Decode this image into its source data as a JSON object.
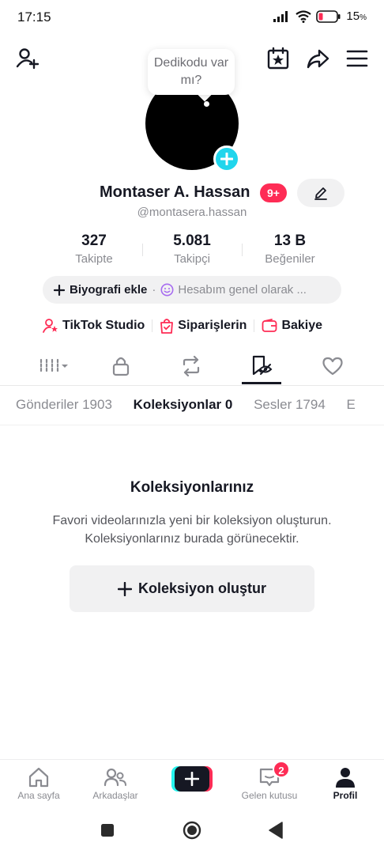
{
  "status_bar": {
    "time": "17:15",
    "battery_percent": "15",
    "battery_sign": "%",
    "icons": [
      "signal-icon",
      "wifi-icon",
      "battery-low-icon"
    ]
  },
  "top_bar": {
    "icons": [
      "add-friend-icon",
      "calendar-star-icon",
      "share-icon",
      "menu-icon"
    ]
  },
  "profile": {
    "note_bubble": "Dedikodu var mı?",
    "display_name": "Montaser A. Hassan",
    "badge": "9+",
    "username": "@montasera.hassan",
    "stats": [
      {
        "value": "327",
        "label": "Takipte"
      },
      {
        "value": "5.081",
        "label": "Takipçi"
      },
      {
        "value": "13 B",
        "label": "Beğeniler"
      }
    ],
    "bio_add_label": "Biyografi ekle",
    "bio_separator": "·",
    "status_text": "Hesabım genel olarak ..."
  },
  "shortcuts": [
    {
      "label": "TikTok Studio",
      "icon": "studio-icon"
    },
    {
      "label": "Siparişlerin",
      "icon": "orders-bag-icon"
    },
    {
      "label": "Bakiye",
      "icon": "wallet-icon"
    }
  ],
  "content_tabs": {
    "icons": [
      "grid-icon",
      "lock-icon",
      "repost-icon",
      "collection-icon",
      "heart-icon"
    ],
    "active_index": 3
  },
  "sub_tabs": [
    {
      "label": "Gönderiler 1903",
      "active": false
    },
    {
      "label": "Koleksiyonlar 0",
      "active": true
    },
    {
      "label": "Sesler 1794",
      "active": false
    },
    {
      "label": "E",
      "active": false
    }
  ],
  "empty_state": {
    "title": "Koleksiyonlarınız",
    "line1": "Favori videolarınızla yeni bir koleksiyon oluşturun.",
    "line2": "Koleksiyonlarınız burada görünecektir.",
    "button_label": "Koleksiyon oluştur"
  },
  "bottom_nav": {
    "home": "Ana sayfa",
    "friends": "Arkadaşlar",
    "inbox": "Gelen kutusu",
    "inbox_badge": "2",
    "profile": "Profil"
  },
  "colors": {
    "accent_red": "#fe2c55",
    "accent_cyan": "#20d5ec",
    "text_primary": "#161823",
    "text_secondary": "#8a8b91"
  }
}
